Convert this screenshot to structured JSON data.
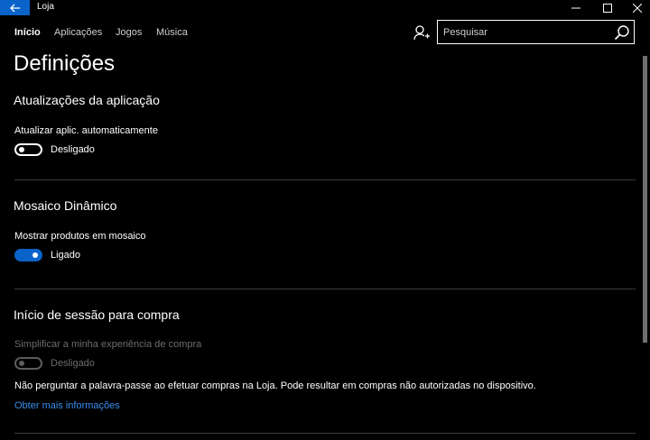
{
  "window": {
    "title": "Loja"
  },
  "nav": {
    "items": [
      {
        "label": "Início"
      },
      {
        "label": "Aplicações"
      },
      {
        "label": "Jogos"
      },
      {
        "label": "Música"
      }
    ]
  },
  "search": {
    "placeholder": "Pesquisar",
    "value": ""
  },
  "page": {
    "title": "Definições"
  },
  "sections": {
    "app_updates": {
      "title": "Atualizações da aplicação",
      "setting_label": "Atualizar aplic. automaticamente",
      "toggle_state": "Desligado"
    },
    "live_tile": {
      "title": "Mosaico Dinâmico",
      "setting_label": "Mostrar produtos em mosaico",
      "toggle_state": "Ligado"
    },
    "purchase_signin": {
      "title": "Início de sessão para compra",
      "setting_label": "Simplificar a minha experiência de compra",
      "toggle_state": "Desligado",
      "description": "Não perguntar a palavra-passe ao efetuar compras na Loja. Pode resultar em compras não autorizadas no dispositivo.",
      "link": "Obter mais informações"
    }
  },
  "colors": {
    "accent": "#0a63c9",
    "link": "#3b8ff0",
    "background": "#000000"
  }
}
